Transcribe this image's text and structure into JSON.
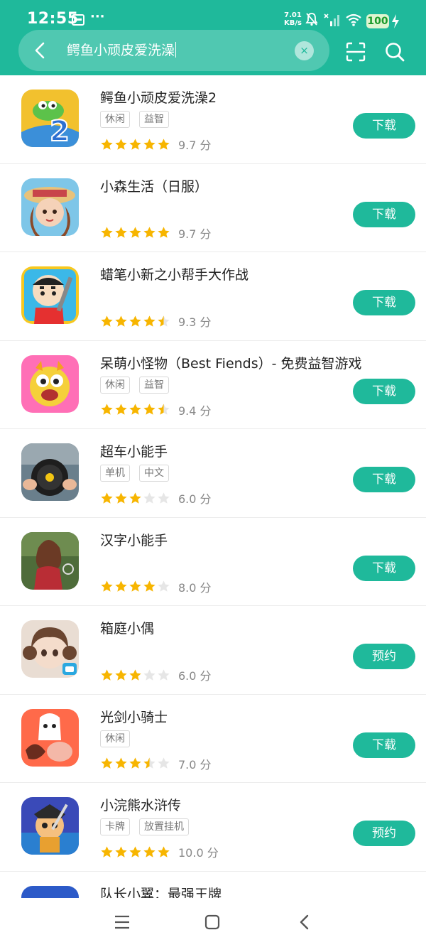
{
  "status_bar": {
    "time": "12:55",
    "more": "···",
    "speed_value": "7.01",
    "speed_unit": "KB/s",
    "battery": "100"
  },
  "search": {
    "query": "鳄鱼小顽皮爱洗澡",
    "clear_label": "×"
  },
  "apps": [
    {
      "name": "鳄鱼小顽皮爱洗澡2",
      "tags": [
        "休闲",
        "益智"
      ],
      "stars": 5,
      "score": "9.7 分",
      "action": "下载",
      "icon": "crocodile-2-icon"
    },
    {
      "name": "小森生活（日服）",
      "tags": [],
      "stars": 5,
      "score": "9.7 分",
      "action": "下载",
      "icon": "girl-straw-hat-icon"
    },
    {
      "name": "蜡笔小新之小帮手大作战",
      "tags": [],
      "stars": 4.5,
      "score": "9.3 分",
      "action": "下载",
      "icon": "crayon-shin-chan-icon"
    },
    {
      "name": "呆萌小怪物（Best Fiends）- 免费益智游戏",
      "tags": [
        "休闲",
        "益智"
      ],
      "stars": 4.5,
      "score": "9.4 分",
      "action": "下载",
      "icon": "yellow-monster-icon"
    },
    {
      "name": "超车小能手",
      "tags": [
        "单机",
        "中文"
      ],
      "stars": 3,
      "score": "6.0 分",
      "action": "下载",
      "icon": "steering-wheel-icon"
    },
    {
      "name": "汉字小能手",
      "tags": [],
      "stars": 4,
      "score": "8.0 分",
      "action": "下载",
      "icon": "woman-red-dress-icon"
    },
    {
      "name": "箱庭小偶",
      "tags": [],
      "stars": 3,
      "score": "6.0 分",
      "action": "预约",
      "icon": "doll-girl-icon"
    },
    {
      "name": "光剑小骑士",
      "tags": [
        "休闲"
      ],
      "stars": 3.5,
      "score": "7.0 分",
      "action": "下载",
      "icon": "ghost-knight-icon"
    },
    {
      "name": "小浣熊水浒传",
      "tags": [
        "卡牌",
        "放置挂机"
      ],
      "stars": 5,
      "score": "10.0 分",
      "action": "预约",
      "icon": "raccoon-warrior-icon"
    },
    {
      "name": "队长小翼：最强王牌",
      "tags": [],
      "stars": 0,
      "score": "",
      "action": "",
      "icon": "soccer-player-icon"
    }
  ],
  "colors": {
    "accent": "#1fb99b",
    "star": "#f7b500",
    "star_empty": "#e6e6e6"
  }
}
